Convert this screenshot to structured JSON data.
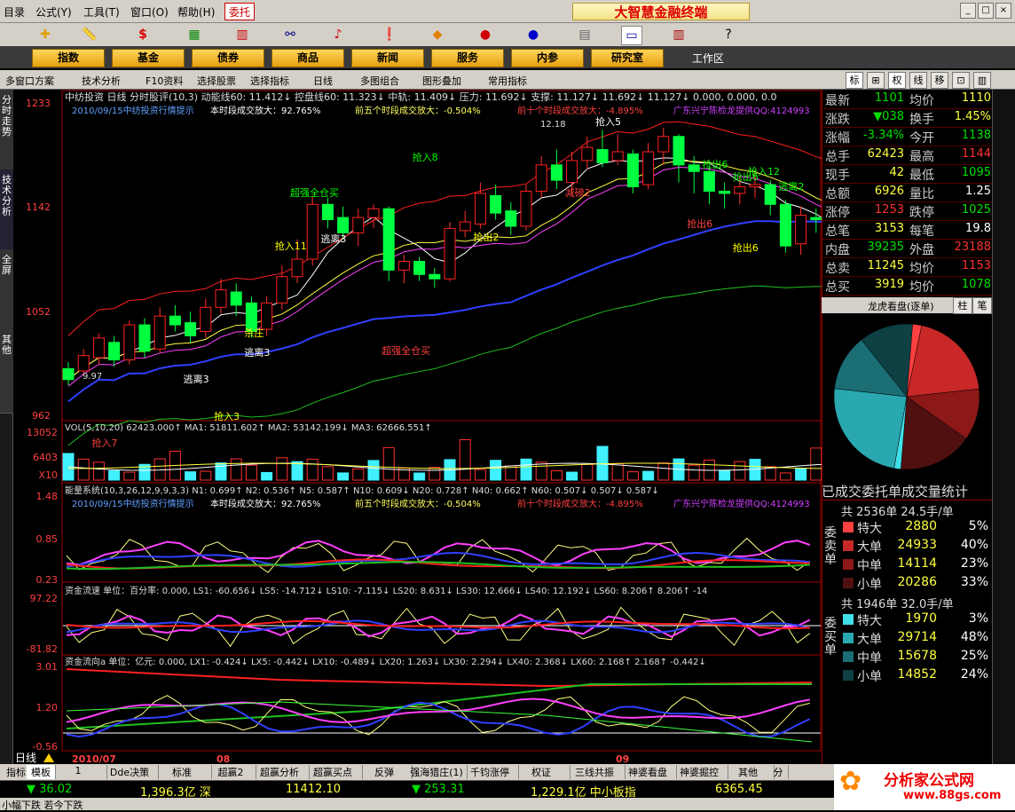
{
  "menu": {
    "items": [
      "目录",
      "公式(Y)",
      "工具(T)",
      "窗口(O)",
      "帮助(H)"
    ],
    "weituo": "委托",
    "title": "大智慧金融终端"
  },
  "nav": {
    "buttons": [
      "指数",
      "基金",
      "债券",
      "商品",
      "新闻",
      "服务",
      "内参",
      "研究室"
    ],
    "workspace": "工作区"
  },
  "charttools": {
    "items": [
      "多窗口方案",
      "技术分析",
      "F10资料",
      "选择股票",
      "选择指标",
      "日线",
      "多图组合",
      "图形叠加",
      "常用指标"
    ],
    "right_tabs": [
      "标",
      "⊞",
      "权",
      "线",
      "移",
      "⊡",
      "▥"
    ]
  },
  "side_tabs": [
    "分时走势",
    "技术分析",
    "全屏",
    "其他"
  ],
  "main_chart": {
    "header": "中纺投资 日线  分时股评(10,3) 动能线60: 11.412↓ 控盘线60: 11.323↓ 中轨: 11.409↓ 压力: 11.692↓ 支撑: 11.127↓ 11.692↓ 11.127↓ 0.000, 0.000, 0.0",
    "note": "2010/09/15中纺投资行情提示",
    "note2": "本时段成交放大：92.765%",
    "note3": "前五个时段成交放大：-0.504%",
    "note4": "前十个时段成交放大：-4.895%",
    "note5": "广东兴宁陈检龙提供QQ:4124993",
    "y_ticks": [
      "1233",
      "1142",
      "1052",
      "962"
    ],
    "signals": [
      "抢入7",
      "逃离3",
      "逃离3",
      "抢入3",
      "杀庄",
      "逃离3",
      "超强全仓买",
      "抢入11",
      "超强全仓买",
      "抢出2",
      "抢入8",
      "减磅2",
      "抢入5",
      "抢出6",
      "抢出6",
      "抢出6",
      "逃离2",
      "抢入12",
      "抢出6"
    ],
    "max_label": "12.18",
    "min_label": "9.97"
  },
  "vol_panel": {
    "header": "VOL(5,10,20)  62423.000↑  MA1: 51811.602↑  MA2: 53142.199↓  MA3: 62666.551↑",
    "y_ticks": [
      "13052",
      "6403",
      "X10"
    ]
  },
  "energy_panel": {
    "header": "能量系统(10,3,26,12,9,9,3,3)  N1: 0.699↑ N2: 0.536↑ N5: 0.587↑ N10: 0.609↓ N20: 0.728↑ N40: 0.662↑ N60: 0.507↓ 0.507↓ 0.587↓",
    "y_ticks": [
      "1.48",
      "0.85",
      "0.23"
    ]
  },
  "flow_panel": {
    "header": "资金流速 单位：百分率: 0.000, LS1: -60.656↓ LS5: -14.712↓ LS10: -7.115↓ LS20: 8.631↓ LS30: 12.666↓ LS40: 12.192↓ LS60: 8.206↑ 8.206↑ -14",
    "y_ticks": [
      "97.22",
      "-81.82"
    ]
  },
  "dir_panel": {
    "header": "资金流向a 单位：亿元: 0.000, LX1: -0.424↓ LX5: -0.442↓ LX10: -0.489↓ LX20: 1.263↓ LX30: 2.294↓ LX40: 2.368↓ LX60: 2.168↑ 2.168↑ -0.442↓",
    "y_ticks": [
      "3.01",
      "1.20",
      "-0.56"
    ]
  },
  "x_axis": {
    "period": "日线",
    "labels": [
      "2010/07",
      "08",
      "09"
    ]
  },
  "quote": [
    {
      "l": "最新",
      "v": "1101",
      "c": "grn",
      "l2": "均价",
      "v2": "1110",
      "c2": "yel"
    },
    {
      "l": "涨跌",
      "v": "▼038",
      "c": "grn",
      "l2": "换手",
      "v2": "1.45%",
      "c2": "yel"
    },
    {
      "l": "涨幅",
      "v": "-3.34%",
      "c": "grn",
      "l2": "今开",
      "v2": "1138",
      "c2": "grn"
    },
    {
      "l": "总手",
      "v": "62423",
      "c": "yel",
      "l2": "最高",
      "v2": "1144",
      "c2": "red"
    },
    {
      "l": "现手",
      "v": "42",
      "c": "yel",
      "l2": "最低",
      "v2": "1095",
      "c2": "grn"
    },
    {
      "l": "总额",
      "v": "6926",
      "c": "yel",
      "l2": "量比",
      "v2": "1.25",
      "c2": "wht"
    },
    {
      "l": "涨停",
      "v": "1253",
      "c": "red",
      "l2": "跌停",
      "v2": "1025",
      "c2": "grn"
    },
    {
      "l": "总笔",
      "v": "3153",
      "c": "yel",
      "l2": "每笔",
      "v2": "19.8",
      "c2": "wht"
    },
    {
      "l": "内盘",
      "v": "39235",
      "c": "grn",
      "l2": "外盘",
      "v2": "23188",
      "c2": "red"
    },
    {
      "l": "总卖",
      "v": "11245",
      "c": "yel",
      "l2": "均价",
      "v2": "1153",
      "c2": "red"
    },
    {
      "l": "总买",
      "v": "3919",
      "c": "yel",
      "l2": "均价",
      "v2": "1078",
      "c2": "grn"
    }
  ],
  "lhkp": {
    "title": "龙虎看盘(逐单)",
    "tabs": [
      "柱",
      "笔"
    ]
  },
  "orders": {
    "title": "已成交委托单成交量统计",
    "sell_head": "共 2536单 24.5手/单",
    "sell_label": "委卖单",
    "sell": [
      {
        "n": "特大",
        "v": "2880",
        "p": "5%",
        "color": "#ff4040"
      },
      {
        "n": "大单",
        "v": "24933",
        "p": "40%",
        "color": "#c82828"
      },
      {
        "n": "中单",
        "v": "14114",
        "p": "23%",
        "color": "#8c1818"
      },
      {
        "n": "小单",
        "v": "20286",
        "p": "33%",
        "color": "#501010"
      }
    ],
    "buy_head": "共 1946单 32.0手/单",
    "buy_label": "委买单",
    "buy": [
      {
        "n": "特大",
        "v": "1970",
        "p": "3%",
        "color": "#40e0e8"
      },
      {
        "n": "大单",
        "v": "29714",
        "p": "48%",
        "color": "#2aa8b0"
      },
      {
        "n": "中单",
        "v": "15678",
        "p": "25%",
        "color": "#1a6e74"
      },
      {
        "n": "小单",
        "v": "14852",
        "p": "24%",
        "color": "#0e4044"
      }
    ]
  },
  "bottom_tabs": [
    "指标",
    "模板",
    "1",
    "Dde决策",
    "标准",
    "超赢2",
    "超赢分析",
    "超赢买点",
    "反弹",
    "强海猎庄(1)",
    "千钧涨停",
    "权证",
    "三线共振",
    "神婆看盘",
    "神婆掘控",
    "其他",
    "分"
  ],
  "status": {
    "s1": "▼ 36.02",
    "s2": "1,396.3亿 深",
    "s3": "11412.10",
    "s4": "▼ 253.31",
    "s5": "1,229.1亿 中小板指",
    "s6": "6365.45"
  },
  "footer": "小幅下跌 若今下跌",
  "logo": {
    "line1": "分析家公式网",
    "line2": "www.88gs.com"
  }
}
